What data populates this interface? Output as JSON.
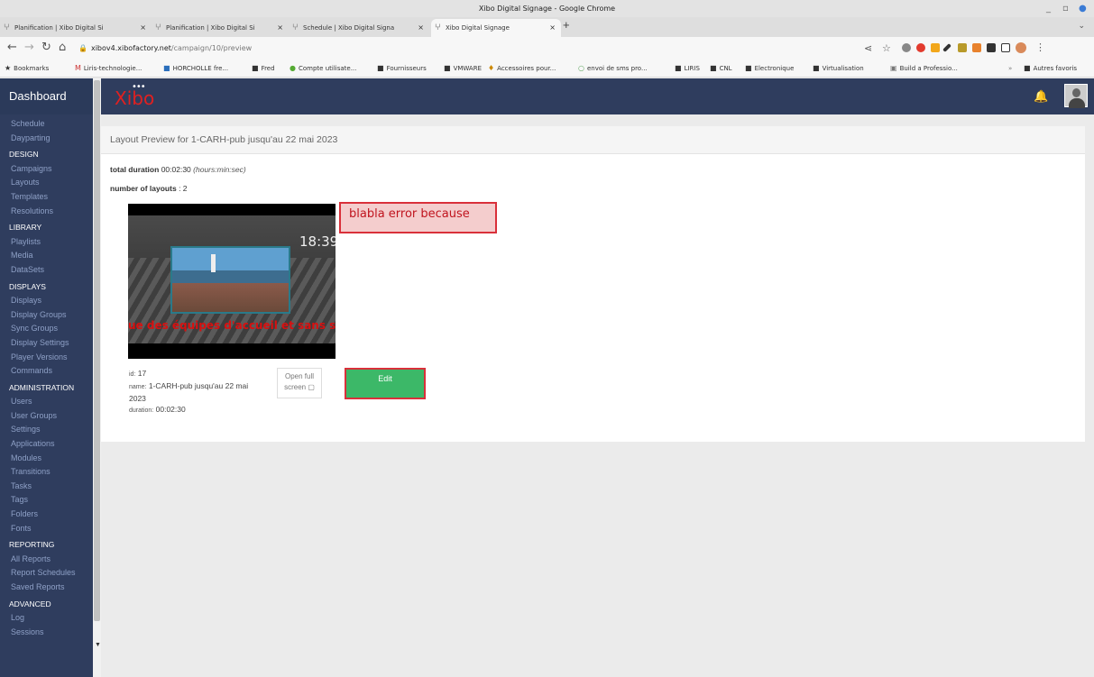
{
  "window": {
    "title": "Xibo Digital Signage - Google Chrome",
    "controls": [
      "_",
      "▫",
      "●"
    ]
  },
  "tabs": [
    {
      "label": "Planification | Xibo Digital Si",
      "active": false
    },
    {
      "label": "Planification | Xibo Digital Si",
      "active": false
    },
    {
      "label": "Schedule | Xibo Digital Signa",
      "active": false
    },
    {
      "label": "Xibo Digital Signage",
      "active": true
    }
  ],
  "tab_close": "×",
  "new_tab": "+",
  "address": {
    "host": "xibov4.xibofactory.net",
    "path": "/campaign/10/preview"
  },
  "nav_icons": [
    "back-icon",
    "forward-icon",
    "reload-icon",
    "home-icon"
  ],
  "bookmarks": [
    "Bookmarks",
    "Liris-technologie...",
    "HORCHOLLE fre...",
    "Fred",
    "Compte utilisate...",
    "Fournisseurs",
    "VMWARE",
    "Accessoires pour...",
    "envoi de sms pro...",
    "LIRIS",
    "CNL",
    "Electronique",
    "Virtualisation",
    "Build a Professio..."
  ],
  "bookmarks_more": "»",
  "other_bookmarks": "Autres favoris",
  "sidebar": {
    "brand": "Dashboard",
    "top_items": [
      "Schedule",
      "Dayparting"
    ],
    "sections": [
      {
        "title": "DESIGN",
        "items": [
          "Campaigns",
          "Layouts",
          "Templates",
          "Resolutions"
        ]
      },
      {
        "title": "LIBRARY",
        "items": [
          "Playlists",
          "Media",
          "DataSets"
        ]
      },
      {
        "title": "DISPLAYS",
        "items": [
          "Displays",
          "Display Groups",
          "Sync Groups",
          "Display Settings",
          "Player Versions",
          "Commands"
        ]
      },
      {
        "title": "ADMINISTRATION",
        "items": [
          "Users",
          "User Groups",
          "Settings",
          "Applications",
          "Modules",
          "Transitions",
          "Tasks",
          "Tags",
          "Folders",
          "Fonts"
        ]
      },
      {
        "title": "REPORTING",
        "items": [
          "All Reports",
          "Report Schedules",
          "Saved Reports"
        ]
      },
      {
        "title": "ADVANCED",
        "items": [
          "Log",
          "Sessions"
        ]
      }
    ]
  },
  "topnav": {
    "logo": "Xibo"
  },
  "panel": {
    "title": "Layout Preview for 1-CARH-pub jusqu'au 22 mai 2023",
    "total_duration_label": "total duration",
    "total_duration_value": "00:02:30",
    "total_duration_unit": "(hours:min:sec)",
    "num_layouts_label": "number of layouts",
    "num_layouts_value": ": 2"
  },
  "layout": {
    "clock": "18:39",
    "ticker": "ue des équipes d'accueil et sans soins",
    "id_label": "id:",
    "id_value": "17",
    "name_label": "name:",
    "name_value": "1-CARH-pub jusqu'au 22 mai 2023",
    "duration_label": "duration:",
    "duration_value": "00:02:30",
    "fullscreen_label": "Open full screen",
    "fullscreen_icon": "expand-icon",
    "edit_label": "Edit"
  },
  "error_note": "blabla error because",
  "colors": {
    "sidebar": "#2f3d5e",
    "accent_red": "#d9303a",
    "edit_green": "#3cb868",
    "logo_red": "#e02020"
  }
}
